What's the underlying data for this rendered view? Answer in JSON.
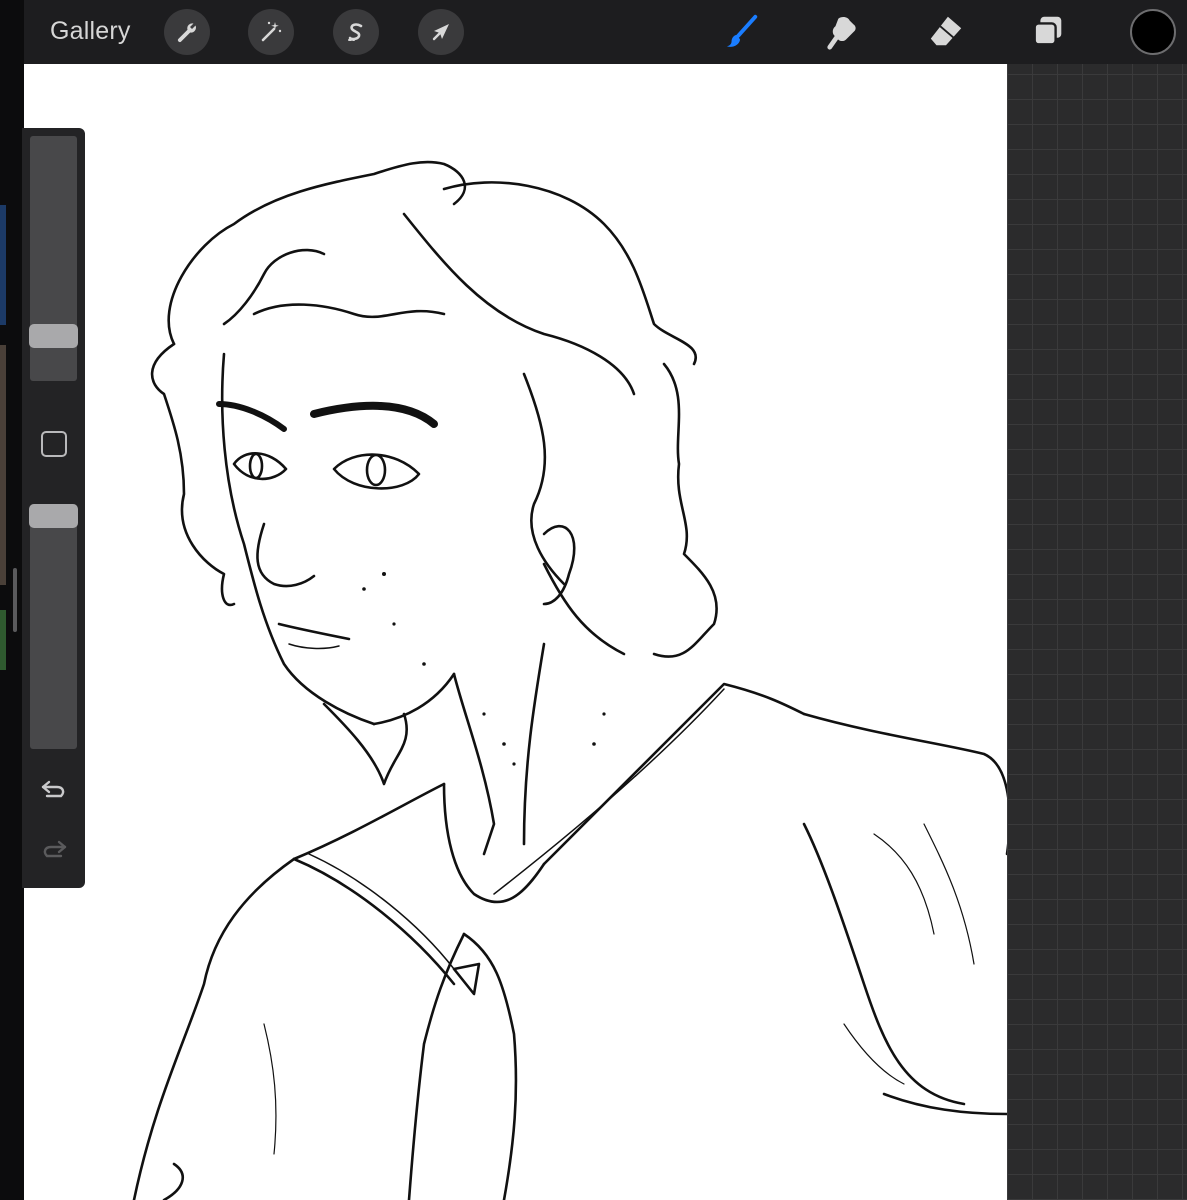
{
  "app": {
    "gallery_label": "Gallery",
    "colors": {
      "toolbar_bg": "#1d1d1f",
      "accent_blue": "#1a7dff",
      "canvas_bg": "#ffffff",
      "current_color": "#000000"
    }
  },
  "toolbar": {
    "left_tools": [
      {
        "name": "actions",
        "icon": "wrench-icon"
      },
      {
        "name": "adjustments",
        "icon": "magic-wand-icon"
      },
      {
        "name": "selection",
        "icon": "selection-s-icon"
      },
      {
        "name": "transform",
        "icon": "arrow-cursor-icon"
      }
    ],
    "right_tools": [
      {
        "name": "brush",
        "icon": "brush-icon",
        "active": true
      },
      {
        "name": "smudge",
        "icon": "smudge-icon",
        "active": false
      },
      {
        "name": "eraser",
        "icon": "eraser-icon",
        "active": false
      },
      {
        "name": "layers",
        "icon": "layers-icon",
        "active": false
      }
    ]
  },
  "sidebar": {
    "brush_size_level": 0.78,
    "opacity_level": 1.0,
    "buttons": [
      "modify-square-icon",
      "undo-icon",
      "redo-icon"
    ]
  }
}
